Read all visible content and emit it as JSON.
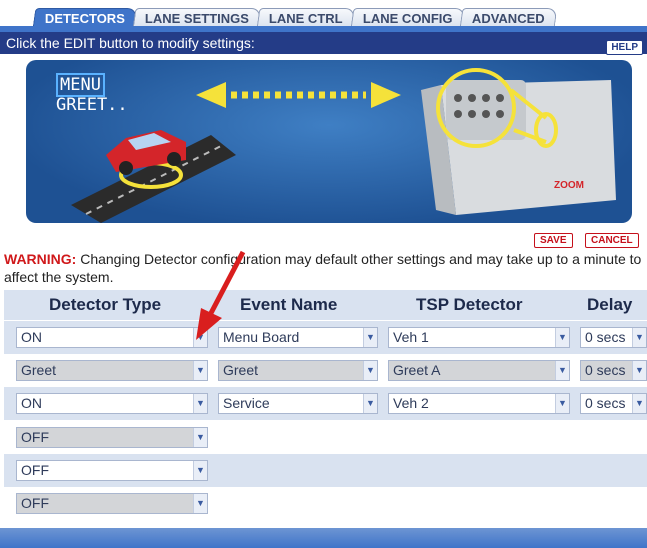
{
  "tabs": [
    {
      "label": "DETECTORS",
      "active": true
    },
    {
      "label": "LANE SETTINGS",
      "active": false
    },
    {
      "label": "LANE CTRL",
      "active": false
    },
    {
      "label": "LANE CONFIG",
      "active": false
    },
    {
      "label": "ADVANCED",
      "active": false
    }
  ],
  "instruction": "Click the EDIT button to modify settings:",
  "help_label": "HELP",
  "illustration": {
    "menu_line1": "MENU",
    "menu_line2": "GREET..",
    "device_logo": "ZOOM"
  },
  "save_label": "SAVE",
  "cancel_label": "CANCEL",
  "warning": {
    "prefix": "WARNING:",
    "text": " Changing Detector configuration may default other settings and may take up to a minute to affect the system."
  },
  "table": {
    "headers": [
      "Detector Type",
      "Event Name",
      "TSP Detector",
      "Delay"
    ],
    "rows": [
      {
        "detector_type": "ON",
        "event_name": "Menu Board",
        "tsp_detector": "Veh 1",
        "delay": "0 secs"
      },
      {
        "detector_type": "Greet",
        "event_name": "Greet",
        "tsp_detector": "Greet A",
        "delay": "0 secs"
      },
      {
        "detector_type": "ON",
        "event_name": "Service",
        "tsp_detector": "Veh 2",
        "delay": "0 secs"
      },
      {
        "detector_type": "OFF"
      },
      {
        "detector_type": "OFF"
      },
      {
        "detector_type": "OFF"
      }
    ]
  },
  "colors": {
    "accent": "#3f74c9",
    "instruction_bar": "#243c87",
    "warning": "#d0191b"
  }
}
